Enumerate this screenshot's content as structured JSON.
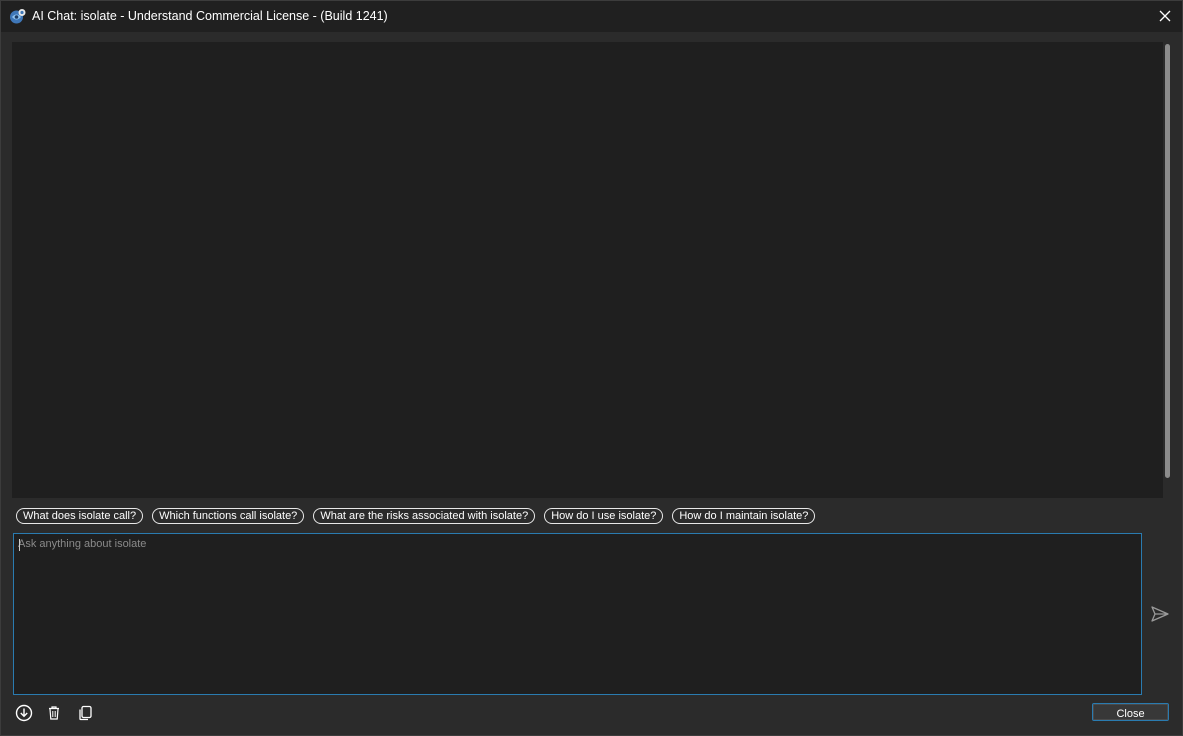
{
  "window": {
    "title": "AI Chat: isolate - Understand Commercial License - (Build 1241)",
    "app_icon": "understand-app-icon",
    "close_icon": "close-icon"
  },
  "suggestions": [
    "What does isolate call?",
    "Which functions call isolate?",
    "What are the risks associated with isolate?",
    "How do I use isolate?",
    "How do I maintain isolate?"
  ],
  "input": {
    "placeholder": "Ask anything about isolate",
    "value": ""
  },
  "toolbar": {
    "icons": [
      "download-icon",
      "trash-icon",
      "copy-icon"
    ],
    "send_icon": "send-icon",
    "close_label": "Close"
  },
  "colors": {
    "background": "#2b2b2b",
    "panel": "#1f1f1f",
    "accent": "#2a7bb0",
    "text": "#ffffff"
  }
}
